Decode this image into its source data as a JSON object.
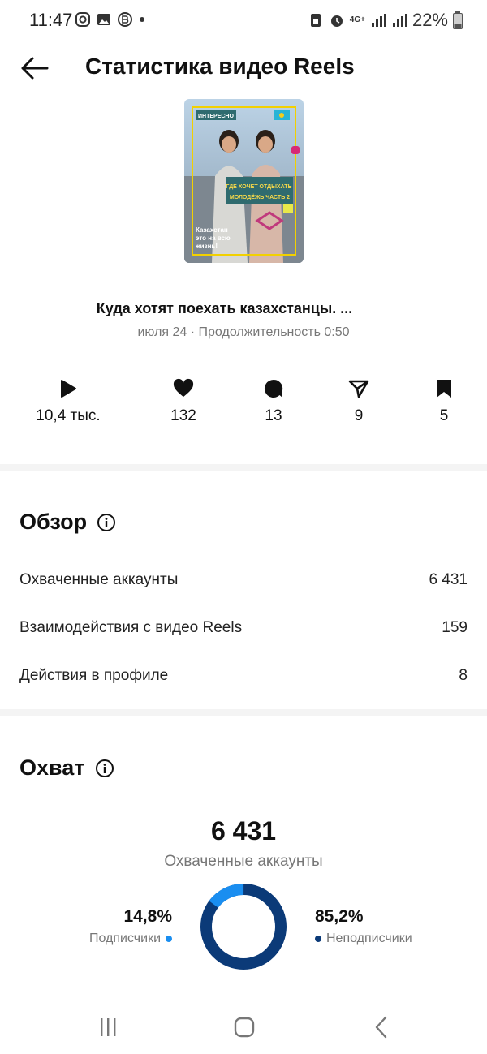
{
  "status_bar": {
    "time": "11:47",
    "network": "4G+",
    "battery": "22%",
    "icons_left": [
      "instagram-icon",
      "gallery-icon",
      "vk-icon",
      "dot-icon"
    ],
    "icons_right": [
      "sim-icon",
      "alarm-icon",
      "network-4g-icon",
      "signal-icon",
      "signal-icon",
      "battery-icon"
    ]
  },
  "header": {
    "title": "Статистика видео Reels",
    "back_icon": "arrow-left-icon"
  },
  "reel": {
    "thumbnail": {
      "badge": "ИНТЕРЕСНО",
      "caption": "ГДЕ ХОЧЕТ ОТДЫХАТЬ МОЛОДЁЖЬ ЧАСТЬ 2",
      "side_text": "Казахстан это на всю жизнь!"
    },
    "title": "Куда хотят поехать казахстанцы. ...",
    "meta": "июля 24 · Продолжительность 0:50"
  },
  "metrics": [
    {
      "icon": "play-icon",
      "value": "10,4 тыс."
    },
    {
      "icon": "heart-icon",
      "value": "132"
    },
    {
      "icon": "comment-icon",
      "value": "13"
    },
    {
      "icon": "share-icon",
      "value": "9"
    },
    {
      "icon": "bookmark-icon",
      "value": "5"
    }
  ],
  "overview": {
    "title": "Обзор",
    "rows": [
      {
        "label": "Охваченные аккаунты",
        "value": "6 431"
      },
      {
        "label": "Взаимодействия с видео Reels",
        "value": "159"
      },
      {
        "label": "Действия в профиле",
        "value": "8"
      }
    ]
  },
  "reach": {
    "title": "Охват",
    "total": "6 431",
    "total_label": "Охваченные аккаунты",
    "followers": {
      "pct": "14,8%",
      "label": "Подписчики",
      "color": "#1a8ef0"
    },
    "non_followers": {
      "pct": "85,2%",
      "label": "Неподписчики",
      "color": "#0b3a78"
    }
  },
  "nav": [
    "recents-icon",
    "home-icon",
    "back-icon"
  ]
}
